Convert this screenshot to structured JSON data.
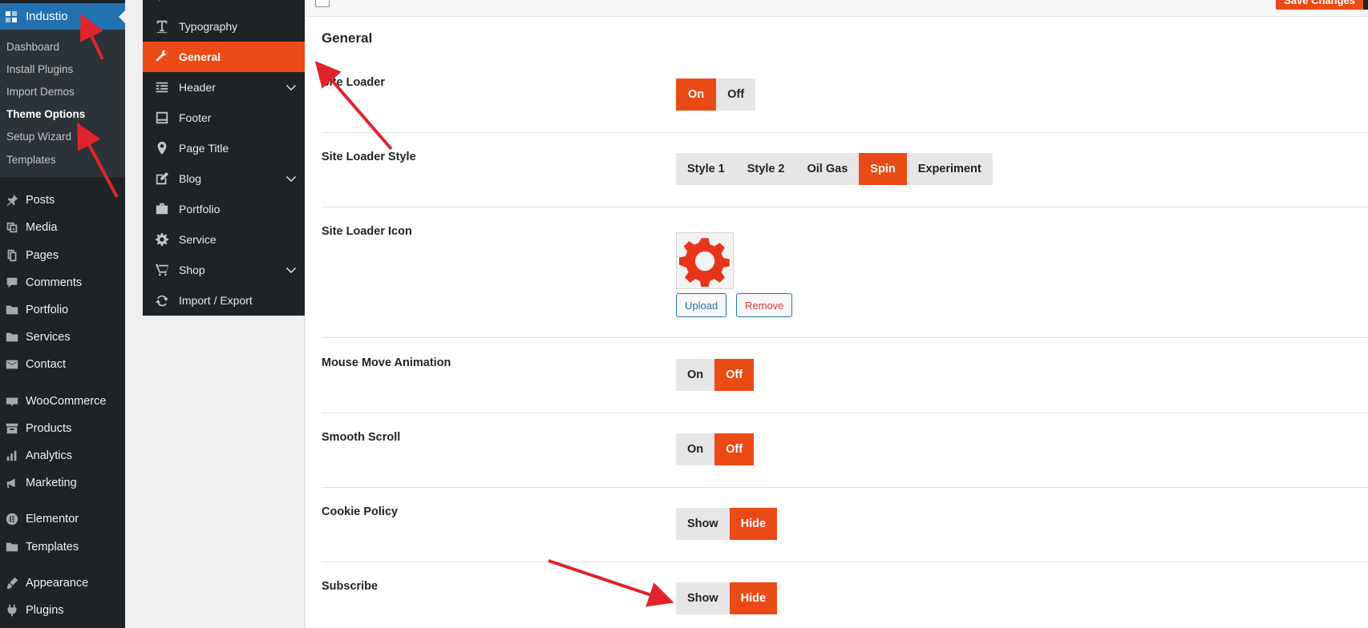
{
  "wp_menu": {
    "brand": "Industio",
    "submenu": [
      {
        "label": "Dashboard",
        "current": false
      },
      {
        "label": "Install Plugins",
        "current": false
      },
      {
        "label": "Import Demos",
        "current": false
      },
      {
        "label": "Theme Options",
        "current": true
      },
      {
        "label": "Setup Wizard",
        "current": false
      },
      {
        "label": "Templates",
        "current": false
      }
    ],
    "items": [
      {
        "label": "Posts",
        "icon": "pin-icon"
      },
      {
        "label": "Media",
        "icon": "media-icon"
      },
      {
        "label": "Pages",
        "icon": "pages-icon"
      },
      {
        "label": "Comments",
        "icon": "comments-icon"
      },
      {
        "label": "Portfolio",
        "icon": "folder-icon"
      },
      {
        "label": "Services",
        "icon": "folder-icon"
      },
      {
        "label": "Contact",
        "icon": "mail-icon"
      },
      {
        "label": "WooCommerce",
        "icon": "woo-icon"
      },
      {
        "label": "Products",
        "icon": "archive-icon"
      },
      {
        "label": "Analytics",
        "icon": "bar-chart-icon"
      },
      {
        "label": "Marketing",
        "icon": "megaphone-icon"
      },
      {
        "label": "Elementor",
        "icon": "elementor-icon"
      },
      {
        "label": "Templates",
        "icon": "folder-icon"
      },
      {
        "label": "Appearance",
        "icon": "brush-icon"
      },
      {
        "label": "Plugins",
        "icon": "plugin-icon"
      }
    ]
  },
  "options_nav": {
    "items": [
      {
        "label": "Typography",
        "icon": "typography-icon",
        "active": false,
        "has_children": false
      },
      {
        "label": "General",
        "icon": "wrench-icon",
        "active": true,
        "has_children": false
      },
      {
        "label": "Header",
        "icon": "header-icon",
        "active": false,
        "has_children": true
      },
      {
        "label": "Footer",
        "icon": "footer-icon",
        "active": false,
        "has_children": false
      },
      {
        "label": "Page Title",
        "icon": "location-icon",
        "active": false,
        "has_children": false
      },
      {
        "label": "Blog",
        "icon": "edit-icon",
        "active": false,
        "has_children": true
      },
      {
        "label": "Portfolio",
        "icon": "briefcase-icon",
        "active": false,
        "has_children": false
      },
      {
        "label": "Service",
        "icon": "gear-icon",
        "active": false,
        "has_children": false
      },
      {
        "label": "Shop",
        "icon": "cart-icon",
        "active": false,
        "has_children": true
      },
      {
        "label": "Import / Export",
        "icon": "refresh-icon",
        "active": false,
        "has_children": false
      }
    ]
  },
  "toolbar": {
    "save_label": "Save Changes"
  },
  "section": {
    "title": "General"
  },
  "settings": {
    "site_loader": {
      "label": "Site Loader",
      "options": [
        "On",
        "Off"
      ],
      "selected": "On"
    },
    "site_loader_style": {
      "label": "Site Loader Style",
      "options": [
        "Style 1",
        "Style 2",
        "Oil Gas",
        "Spin",
        "Experiment"
      ],
      "selected": "Spin"
    },
    "site_loader_icon": {
      "label": "Site Loader Icon",
      "upload_label": "Upload",
      "remove_label": "Remove",
      "preview_icon": "gear-icon"
    },
    "mouse_move_animation": {
      "label": "Mouse Move Animation",
      "options": [
        "On",
        "Off"
      ],
      "selected": "Off"
    },
    "smooth_scroll": {
      "label": "Smooth Scroll",
      "options": [
        "On",
        "Off"
      ],
      "selected": "Off"
    },
    "cookie_policy": {
      "label": "Cookie Policy",
      "options": [
        "Show",
        "Hide"
      ],
      "selected": "Hide"
    },
    "subscribe": {
      "label": "Subscribe",
      "options": [
        "Show",
        "Hide"
      ],
      "selected": "Hide"
    }
  },
  "colors": {
    "accent": "#ea4a16",
    "wp_blue": "#2271b1",
    "sidebar": "#1d2327",
    "annotation": "#e0242b"
  }
}
